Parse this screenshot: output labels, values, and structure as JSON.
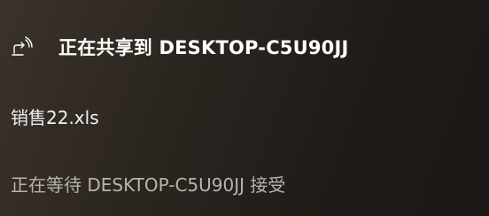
{
  "toast": {
    "icon": "share-icon",
    "title": "正在共享到 DESKTOP-C5U90JJ",
    "filename": "销售22.xls",
    "status": "正在等待 DESKTOP-C5U90JJ 接受"
  },
  "colors": {
    "background": "#2c2620",
    "text_primary": "#ffffff",
    "text_secondary": "#b8b3ad"
  }
}
